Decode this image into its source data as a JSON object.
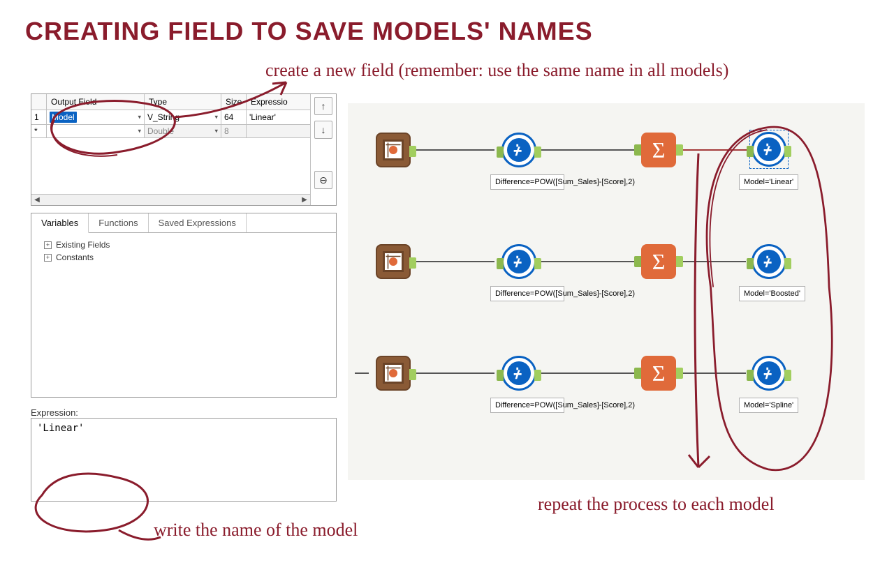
{
  "title": "CREATING FIELD TO SAVE MODELS' NAMES",
  "annotations": {
    "top": "create a new field (remember: use the same name in all models)",
    "bottom_left": "write the name of the model",
    "bottom_right": "repeat the process to each model"
  },
  "grid": {
    "headers": {
      "output_field": "Output Field",
      "type": "Type",
      "size": "Size",
      "expression": "Expressio"
    },
    "row1": {
      "num": "1",
      "field": "Model",
      "type": "V_String",
      "size": "64",
      "expr": "'Linear'"
    },
    "row2": {
      "num": "*",
      "field": "",
      "type": "Double",
      "size": "8",
      "expr": ""
    }
  },
  "side_buttons": {
    "up": "↑",
    "down": "↓",
    "remove": "⊖"
  },
  "tabs": {
    "variables": "Variables",
    "functions": "Functions",
    "saved": "Saved Expressions"
  },
  "tree": {
    "existing_fields": "Existing Fields",
    "constants": "Constants"
  },
  "expression_label": "Expression:",
  "expression_value": "'Linear'",
  "workflow": {
    "formula_label": "Difference=POW([Sum_Sales]-[Score],2)",
    "model_labels": {
      "linear": "Model='Linear'",
      "boosted": "Model='Boosted'",
      "spline": "Model='Spline'"
    }
  },
  "icons": {
    "score_tool": "score-tool-icon",
    "formula_tool": "formula-tool-icon",
    "summarize_tool": "summarize-tool-icon"
  }
}
